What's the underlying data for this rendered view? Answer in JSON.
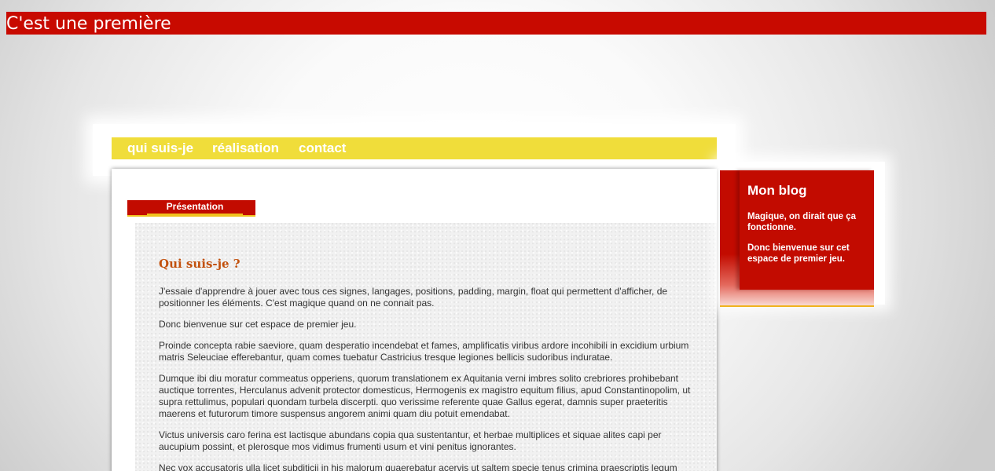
{
  "site": {
    "title": "C'est une première"
  },
  "nav": {
    "items": [
      {
        "label": "qui suis-je"
      },
      {
        "label": "réalisation"
      },
      {
        "label": "contact"
      }
    ]
  },
  "tabs": {
    "active_label": "Présentation"
  },
  "article": {
    "heading": "Qui suis-je ?",
    "paragraphs": [
      "J'essaie d'apprendre à jouer avec tous ces signes, langages, positions, padding, margin, float qui permettent d'afficher, de positionner les éléments. C'est magique quand on ne connait pas.",
      "Donc bienvenue sur cet espace de premier jeu.",
      "Proinde concepta rabie saeviore, quam desperatio incendebat et fames, amplificatis viribus ardore incohibili in excidium urbium matris Seleuciae efferebantur, quam comes tuebatur Castricius tresque legiones bellicis sudoribus induratae.",
      "Dumque ibi diu moratur commeatus opperiens, quorum translationem ex Aquitania verni imbres solito crebriores prohibebant auctique torrentes, Herculanus advenit protector domesticus, Hermogenis ex magistro equitum filius, apud Constantinopolim, ut supra rettulimus, populari quondam turbela discerpti. quo verissime referente quae Gallus egerat, damnis super praeteritis maerens et futurorum timore suspensus angorem animi quam diu potuit emendabat.",
      "Victus universis caro ferina est lactisque abundans copia qua sustentantur, et herbae multiplices et siquae alites capi per aucupium possint, et plerosque mos vidimus frumenti usum et vini penitus ignorantes.",
      "Nec vox accusatoris ulla licet subditicii in his malorum quaerebatur acervis ut saltem specie tenus crimina praescriptis legum"
    ]
  },
  "sidebar": {
    "title": "Mon blog",
    "paragraphs": [
      "Magique, on dirait que ça fonctionne.",
      "Donc bienvenue sur cet espace de premier jeu."
    ]
  },
  "colors": {
    "brand_red": "#c80a00",
    "nav_yellow": "#f0dd3a",
    "heading_orange": "#c2500c",
    "accent_gold": "#f0c21e"
  }
}
